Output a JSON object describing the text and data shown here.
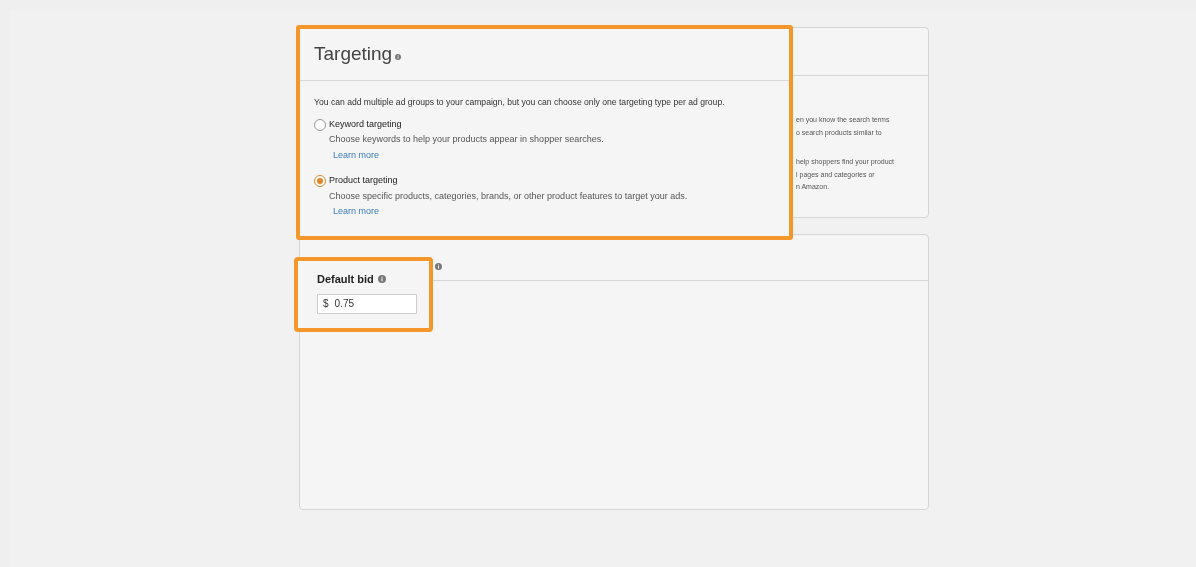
{
  "background_card": {
    "description_lines": [
      "en you know the search terms",
      "o search products similar to",
      "help shoppers find your product",
      "l pages and categories or",
      "n Amazon."
    ]
  },
  "targeting": {
    "title": "Targeting",
    "note": "You can add multiple ad groups to your campaign, but you can choose only one targeting type per ad group.",
    "options": [
      {
        "label": "Keyword targeting",
        "description": "Choose keywords to help your products appear in shopper searches.",
        "link": "Learn more",
        "selected": false
      },
      {
        "label": "Product targeting",
        "description": "Choose specific products, categories, brands, or other product features to target your ads.",
        "link": "Learn more",
        "selected": true
      }
    ]
  },
  "default_bid": {
    "label": "Default bid",
    "currency": "$",
    "value": "0.75"
  }
}
